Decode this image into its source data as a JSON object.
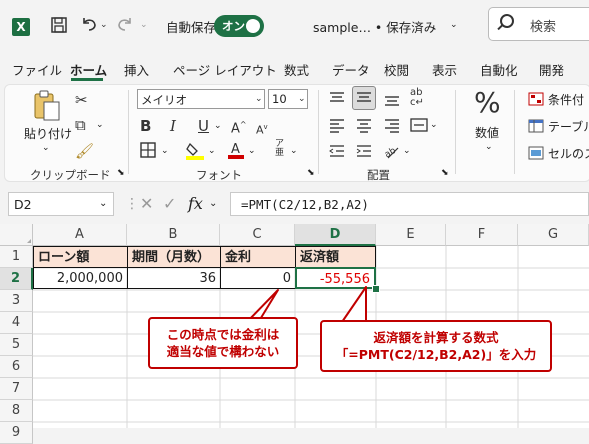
{
  "titlebar": {
    "app_logo": "X",
    "autosave_label": "自動保存",
    "autosave_state": "オン",
    "file_name": "sample… • 保存済み",
    "search_placeholder": "検索",
    "icons": [
      "save-icon",
      "undo-icon",
      "redo-icon"
    ]
  },
  "tabs": [
    "ファイル",
    "ホーム",
    "挿入",
    "ページ レイアウト",
    "数式",
    "データ",
    "校閲",
    "表示",
    "自動化",
    "開発"
  ],
  "active_tab": "ホーム",
  "ribbon": {
    "clipboard": {
      "paste_label": "貼り付け",
      "group_label": "クリップボード"
    },
    "font": {
      "font_name": "メイリオ",
      "font_size": "10",
      "bold": "B",
      "italic": "I",
      "underline": "U",
      "group_label": "フォント",
      "font_color": "#d00000",
      "highlight_color": "#ffff00"
    },
    "alignment": {
      "group_label": "配置"
    },
    "number": {
      "label": "数値",
      "icon_glyph": "%"
    },
    "styles": {
      "conditional": "条件付",
      "table": "テーブル",
      "cell_styles": "セルのス"
    }
  },
  "formula_bar": {
    "name_box": "D2",
    "fx": "fx",
    "formula": "=PMT(C2/12,B2,A2)"
  },
  "sheet": {
    "columns": [
      "A",
      "B",
      "C",
      "D",
      "E",
      "F",
      "G"
    ],
    "rows": [
      "1",
      "2",
      "3",
      "4",
      "5",
      "6",
      "7",
      "8",
      "9"
    ],
    "headers": {
      "A1": "ローン額",
      "B1": "期間（月数）",
      "C1": "金利",
      "D1": "返済額"
    },
    "values": {
      "A2": "2,000,000",
      "B2": "36",
      "C2": "0",
      "D2": "-55,556"
    },
    "active_cell": "D2"
  },
  "callouts": {
    "left": {
      "line1": "この時点では金利は",
      "line2": "適当な値で構わない"
    },
    "right": {
      "line1": "返済額を計算する数式",
      "line2": "「=PMT(C2/12,B2,A2)」を入力"
    }
  },
  "colors": {
    "excel_green": "#1e7145",
    "header_fill": "#fbe3d6",
    "negative": "#e00000",
    "callout": "#c00000"
  }
}
